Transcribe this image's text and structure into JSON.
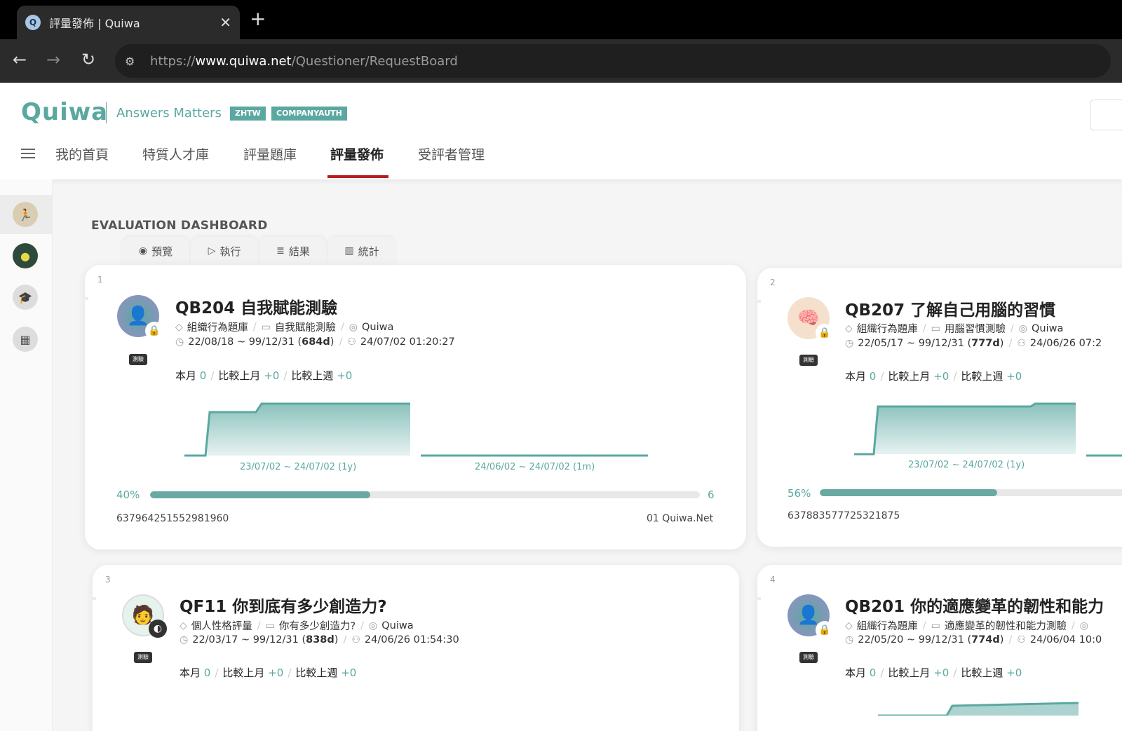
{
  "browser": {
    "tab_title": "評量發佈 | Quiwa",
    "favicon": "Q",
    "url_prefix": "https://",
    "url_host": "www.quiwa.net",
    "url_path": "/Questioner/RequestBoard"
  },
  "header": {
    "logo": "Quiwa",
    "tagline": "Answers Matters",
    "badges": [
      "ZHTW",
      "COMPANYAUTH"
    ],
    "nav": [
      "我的首頁",
      "特質人才庫",
      "評量題庫",
      "評量發佈",
      "受評者管理"
    ],
    "active_nav": "評量發佈"
  },
  "dashboard": {
    "title": "EVALUATION DASHBOARD",
    "tabs": [
      "預覽",
      "執行",
      "結果",
      "統計"
    ]
  },
  "cards": [
    {
      "num": "1",
      "title": "QB204 自我賦能測驗",
      "category": "組織行為題庫",
      "test_name": "自我賦能測驗",
      "owner": "Quiwa",
      "period": "22/08/18 ~ 99/12/31 (",
      "days": "684d",
      "period_end": ")",
      "last_time": "24/07/02 01:20:27",
      "tag": "測驗",
      "stat_month_label": "本月",
      "stat_month": "0",
      "stat_lastmonth_label": "比較上月",
      "stat_lastmonth": "+0",
      "stat_lastweek_label": "比較上週",
      "stat_lastweek": "+0",
      "range_year": "23/07/02 ~ 24/07/02 (1y)",
      "range_month": "24/06/02 ~ 24/07/02 (1m)",
      "progress": 40,
      "progress_label": "40%",
      "count": "6",
      "id": "637964251552981960",
      "org": "01 Quiwa.Net"
    },
    {
      "num": "2",
      "title": "QB207 了解自己用腦的習慣",
      "category": "組織行為題庫",
      "test_name": "用腦習慣測驗",
      "owner": "Quiwa",
      "period": "22/05/17 ~ 99/12/31 (",
      "days": "777d",
      "period_end": ")",
      "last_time": "24/06/26 07:2",
      "tag": "測驗",
      "stat_month_label": "本月",
      "stat_month": "0",
      "stat_lastmonth_label": "比較上月",
      "stat_lastmonth": "+0",
      "stat_lastweek_label": "比較上週",
      "stat_lastweek": "+0",
      "range_year": "23/07/02 ~ 24/07/02 (1y)",
      "progress": 56,
      "progress_label": "56%",
      "id": "637883577725321875"
    },
    {
      "num": "3",
      "title": "QF11 你到底有多少創造力?",
      "category": "個人性格評量",
      "test_name": "你有多少創造力?",
      "owner": "Quiwa",
      "period": "22/03/17 ~ 99/12/31 (",
      "days": "838d",
      "period_end": ")",
      "last_time": "24/06/26 01:54:30",
      "tag": "測驗",
      "stat_month_label": "本月",
      "stat_month": "0",
      "stat_lastmonth_label": "比較上月",
      "stat_lastmonth": "+0",
      "stat_lastweek_label": "比較上週",
      "stat_lastweek": "+0"
    },
    {
      "num": "4",
      "title": "QB201 你的適應變革的韌性和能力",
      "category": "組織行為題庫",
      "test_name": "適應變革的韌性和能力測驗",
      "owner": "",
      "period": "22/05/20 ~ 99/12/31 (",
      "days": "774d",
      "period_end": ")",
      "last_time": "24/06/04 10:0",
      "tag": "測驗",
      "stat_month_label": "本月",
      "stat_month": "0",
      "stat_lastmonth_label": "比較上月",
      "stat_lastmonth": "+0",
      "stat_lastweek_label": "比較上週",
      "stat_lastweek": "+0"
    }
  ],
  "colors": {
    "accent": "#5aa8a0",
    "active_underline": "#b71c1c"
  }
}
